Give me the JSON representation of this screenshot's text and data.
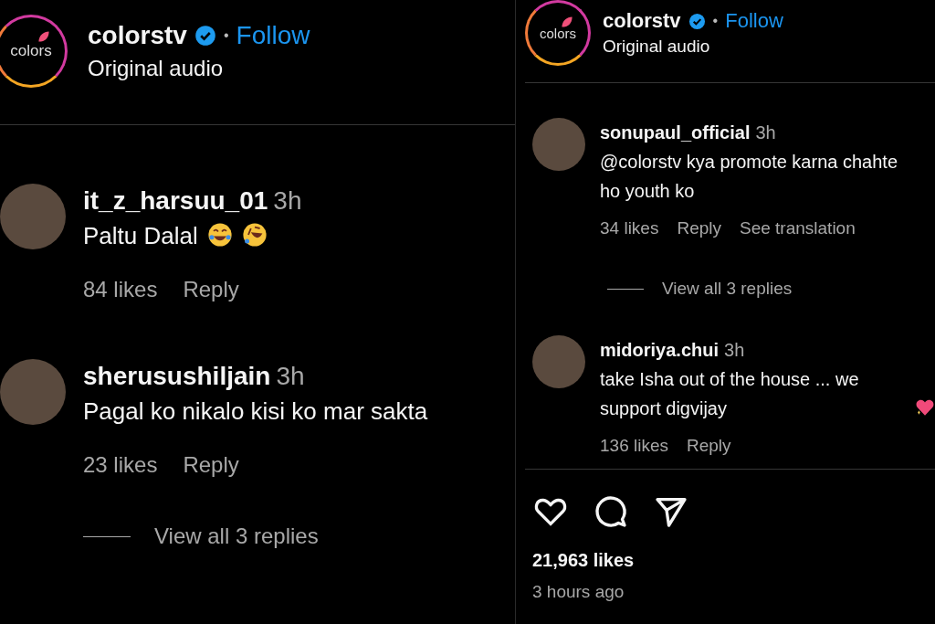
{
  "panels": [
    {
      "header": {
        "logo_text": "colors",
        "username": "colorstv",
        "verified": true,
        "separator": "•",
        "follow": "Follow",
        "subtitle": "Original audio"
      },
      "comments": [
        {
          "username": "it_z_harsuu_01",
          "time": "3h",
          "text": "Paltu Dalal",
          "emojis": [
            {
              "kind": "laughing"
            },
            {
              "kind": "rolling"
            }
          ],
          "likes": "84 likes",
          "reply": "Reply"
        },
        {
          "username": "sherusushiljain",
          "time": "3h",
          "text": "Pagal ko nikalo kisi ko mar sakta",
          "likes": "23 likes",
          "reply": "Reply",
          "view_replies": "View all 3 replies"
        }
      ]
    },
    {
      "header": {
        "logo_text": "colors",
        "username": "colorstv",
        "verified": true,
        "separator": "•",
        "follow": "Follow",
        "subtitle": "Original audio"
      },
      "comments": [
        {
          "username": "sonupaul_official",
          "time": "3h",
          "text": "@colorstv kya promote karna chahte ho youth ko",
          "likes": "34 likes",
          "reply": "Reply",
          "translate": "See translation",
          "view_replies": "View all 3 replies"
        },
        {
          "username": "midoriya.chui",
          "time": "3h",
          "text": "take Isha out of the house ... we support digvijay",
          "emojis": [
            {
              "kind": "heart"
            }
          ],
          "likes": "136 likes",
          "reply": "Reply"
        }
      ],
      "footer": {
        "likes": "21,963 likes",
        "time": "3 hours ago"
      }
    }
  ]
}
